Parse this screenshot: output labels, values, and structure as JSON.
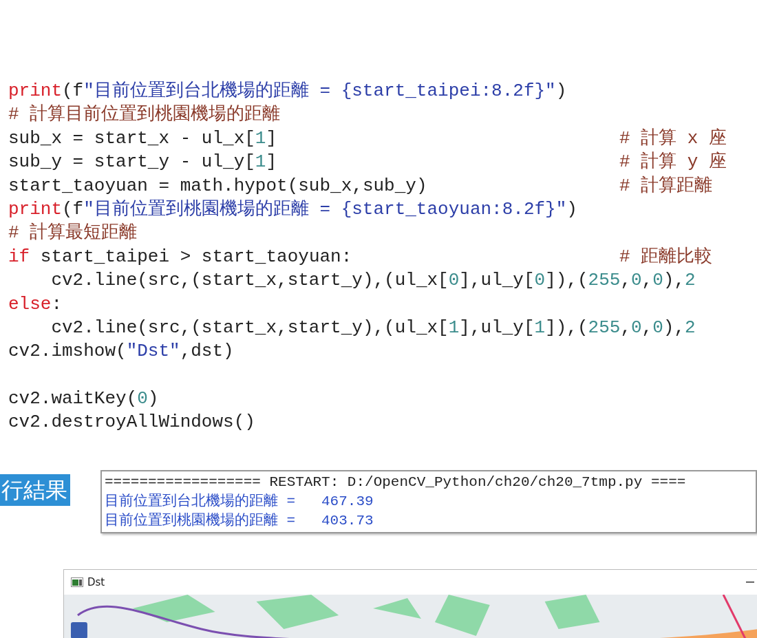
{
  "code_lines": [
    {
      "tokens": [
        {
          "kind": "keyword",
          "text": "print"
        },
        {
          "kind": "plain",
          "text": "(f"
        },
        {
          "kind": "string",
          "text": "\"目前位置到台北機場的距離 = {start_taipei:8.2f}\""
        },
        {
          "kind": "plain",
          "text": ")"
        }
      ]
    },
    {
      "tokens": [
        {
          "kind": "comment",
          "text": "# 計算目前位置到桃園機場的距離"
        }
      ]
    },
    {
      "tokens": [
        {
          "kind": "plain",
          "text": "sub_x = start_x - ul_x["
        },
        {
          "kind": "number",
          "text": "1"
        },
        {
          "kind": "plain",
          "text": "]"
        }
      ],
      "comment": "# 計算 x 座"
    },
    {
      "tokens": [
        {
          "kind": "plain",
          "text": "sub_y = start_y - ul_y["
        },
        {
          "kind": "number",
          "text": "1"
        },
        {
          "kind": "plain",
          "text": "]"
        }
      ],
      "comment": "# 計算 y 座"
    },
    {
      "tokens": [
        {
          "kind": "plain",
          "text": "start_taoyuan = math.hypot(sub_x,sub_y)"
        }
      ],
      "comment": "# 計算距離"
    },
    {
      "tokens": [
        {
          "kind": "keyword",
          "text": "print"
        },
        {
          "kind": "plain",
          "text": "(f"
        },
        {
          "kind": "string",
          "text": "\"目前位置到桃園機場的距離 = {start_taoyuan:8.2f}\""
        },
        {
          "kind": "plain",
          "text": ")"
        }
      ]
    },
    {
      "tokens": [
        {
          "kind": "comment",
          "text": "# 計算最短距離"
        }
      ]
    },
    {
      "tokens": [
        {
          "kind": "keyword",
          "text": "if"
        },
        {
          "kind": "plain",
          "text": " start_taipei > start_taoyuan:"
        }
      ],
      "comment": "# 距離比較"
    },
    {
      "tokens": [
        {
          "kind": "plain",
          "text": "    cv2.line(src,(start_x,start_y),(ul_x["
        },
        {
          "kind": "number",
          "text": "0"
        },
        {
          "kind": "plain",
          "text": "],ul_y["
        },
        {
          "kind": "number",
          "text": "0"
        },
        {
          "kind": "plain",
          "text": "]),("
        },
        {
          "kind": "number",
          "text": "255"
        },
        {
          "kind": "plain",
          "text": ","
        },
        {
          "kind": "number",
          "text": "0"
        },
        {
          "kind": "plain",
          "text": ","
        },
        {
          "kind": "number",
          "text": "0"
        },
        {
          "kind": "plain",
          "text": "),"
        },
        {
          "kind": "number",
          "text": "2"
        }
      ]
    },
    {
      "tokens": [
        {
          "kind": "keyword",
          "text": "else"
        },
        {
          "kind": "plain",
          "text": ":"
        }
      ]
    },
    {
      "tokens": [
        {
          "kind": "plain",
          "text": "    cv2.line(src,(start_x,start_y),(ul_x["
        },
        {
          "kind": "number",
          "text": "1"
        },
        {
          "kind": "plain",
          "text": "],ul_y["
        },
        {
          "kind": "number",
          "text": "1"
        },
        {
          "kind": "plain",
          "text": "]),("
        },
        {
          "kind": "number",
          "text": "255"
        },
        {
          "kind": "plain",
          "text": ","
        },
        {
          "kind": "number",
          "text": "0"
        },
        {
          "kind": "plain",
          "text": ","
        },
        {
          "kind": "number",
          "text": "0"
        },
        {
          "kind": "plain",
          "text": "),"
        },
        {
          "kind": "number",
          "text": "2"
        }
      ]
    },
    {
      "tokens": [
        {
          "kind": "plain",
          "text": "cv2.imshow("
        },
        {
          "kind": "string",
          "text": "\"Dst\""
        },
        {
          "kind": "plain",
          "text": ",dst)"
        }
      ]
    },
    {
      "gap_before": true,
      "tokens": [
        {
          "kind": "plain",
          "text": "cv2.waitKey("
        },
        {
          "kind": "number",
          "text": "0"
        },
        {
          "kind": "plain",
          "text": ")"
        }
      ]
    },
    {
      "tokens": [
        {
          "kind": "plain",
          "text": "cv2.destroyAllWindows()"
        }
      ]
    }
  ],
  "result_label": "行結果",
  "console": {
    "lines": [
      {
        "kind": "restart",
        "text": "================== RESTART: D:/OpenCV_Python/ch20/ch20_7tmp.py ===="
      },
      {
        "kind": "output",
        "text": "目前位置到台北機場的距離 =   467.39"
      },
      {
        "kind": "output",
        "text": "目前位置到桃園機場的距離 =   403.73"
      }
    ]
  },
  "window": {
    "title": "Dst"
  }
}
